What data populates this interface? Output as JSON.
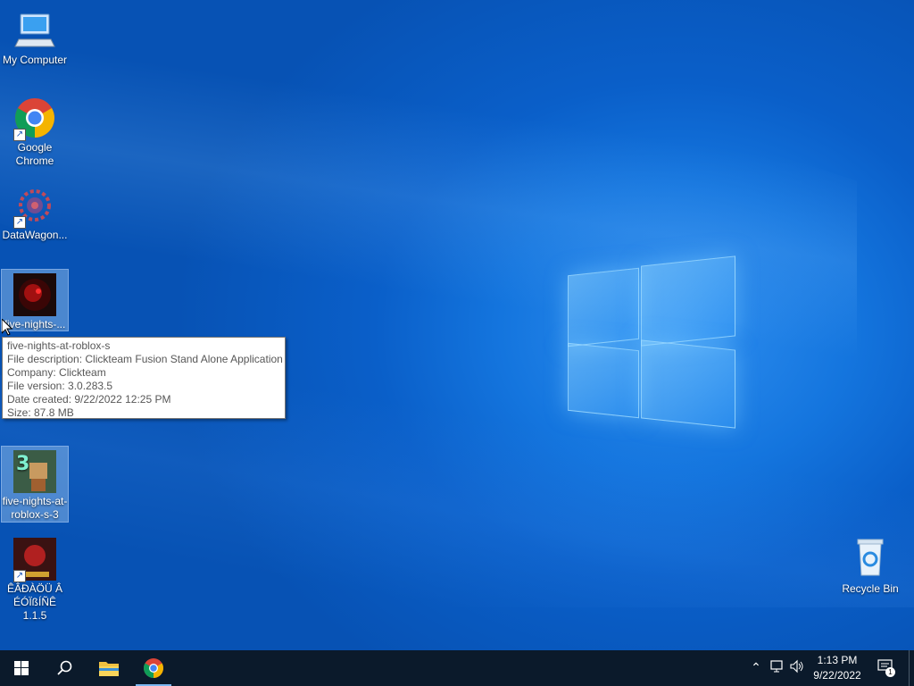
{
  "desktop": {
    "icons": [
      {
        "label": "My Computer"
      },
      {
        "label": "Google Chrome"
      },
      {
        "label": "DataWagon..."
      },
      {
        "label": "five-nights-..."
      },
      {
        "label": "five-nights-at-roblox-s-3"
      },
      {
        "label": "ÊÂÐÀÖÜ Â ÉÓÏßÍÑÊ 1.1.5"
      }
    ],
    "recycle_bin": {
      "label": "Recycle Bin"
    }
  },
  "tooltip": {
    "name": "five-nights-at-roblox-s",
    "description": "File description: Clickteam Fusion Stand Alone Application",
    "company": "Company: Clickteam",
    "version": "File version: 3.0.283.5",
    "created": "Date created: 9/22/2022 12:25 PM",
    "size": "Size: 87.8 MB"
  },
  "taskbar": {
    "pinned": [
      "start-icon",
      "search-icon",
      "file-explorer-icon",
      "chrome-icon"
    ],
    "clock": {
      "time": "1:13 PM",
      "date": "9/22/2022"
    },
    "notification_count": "1"
  },
  "colors": {
    "taskbar": "#0b1a2b",
    "desktop": "#0a5fc9"
  }
}
